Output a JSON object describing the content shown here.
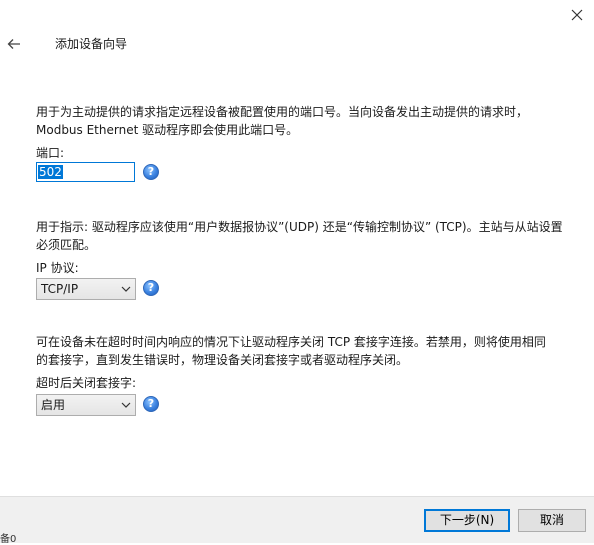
{
  "window": {
    "title": "添加设备向导",
    "close_glyph": "✕",
    "back_glyph": "←"
  },
  "port_section": {
    "description": "用于为主动提供的请求指定远程设备被配置使用的端口号。当向设备发出主动提供的请求时，\nModbus Ethernet 驱动程序即会使用此端口号。",
    "label": "端口:",
    "value": "502"
  },
  "protocol_section": {
    "description": "用于指示: 驱动程序应该使用“用户数据报协议”(UDP) 还是“传输控制协议” (TCP)。主站与从站设置\n必须匹配。",
    "label": "IP 协议:",
    "selected": "TCP/IP"
  },
  "socket_section": {
    "description": "可在设备未在超时时间内响应的情况下让驱动程序关闭 TCP 套接字连接。若禁用，则将使用相同\n的套接字，直到发生错误时，物理设备关闭套接字或者驱动程序关闭。",
    "label": "超时后关闭套接字:",
    "selected": "启用"
  },
  "help": {
    "glyph": "?"
  },
  "footer": {
    "next_label": "下一步(N)",
    "cancel_label": "取消",
    "edge_text": "备0"
  },
  "colors": {
    "accent": "#0078d7",
    "help_icon": "#3b82e0",
    "footer_bg": "#f0f0f0"
  }
}
